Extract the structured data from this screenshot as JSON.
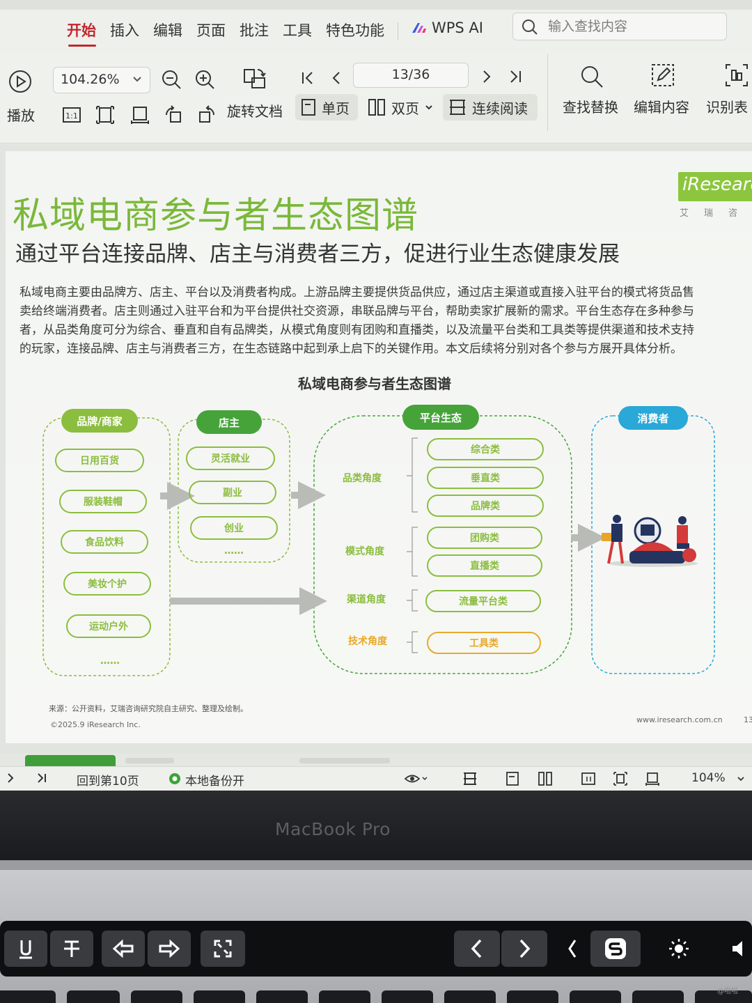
{
  "menu": {
    "items": [
      "开始",
      "插入",
      "编辑",
      "页面",
      "批注",
      "工具",
      "特色功能"
    ],
    "active": "开始",
    "wps_ai": "WPS AI",
    "search_placeholder": "输入查找内容"
  },
  "toolbar": {
    "play_label": "播放",
    "zoom_value": "104.26%",
    "page_indicator": "13/36",
    "rotate_label": "旋转文档",
    "single_page_label": "单页",
    "double_page_label": "双页",
    "continuous_label": "连续阅读",
    "find_replace_label": "查找替换",
    "edit_content_label": "编辑内容",
    "recognize_label": "识别表",
    "fit_label": "1:1"
  },
  "document": {
    "title": "私域电商参与者生态图谱",
    "subtitle": "通过平台连接品牌、店主与消费者三方，促进行业生态健康发展",
    "body_lines": [
      "私域电商主要由品牌方、店主、平台以及消费者构成。上游品牌主要提供货品供应，通过店主渠道或直接入驻平台的模式将货品售",
      "卖给终端消费者。店主则通过入驻平台和为平台提供社交资源，串联品牌与平台，帮助卖家扩展新的需求。平台生态存在多种参与",
      "者，从品类角度可分为综合、垂直和自有品牌类，从模式角度则有团购和直播类，以及流量平台类和工具类等提供渠道和技术支持",
      "的玩家，连接品牌、店主与消费者三方，在生态链路中起到承上启下的关键作用。本文后续将分别对各个参与方展开具体分析。"
    ],
    "logo_text": "iResearch",
    "logo_subtext": "艾瑞咨",
    "diagram_title": "私域电商参与者生态图谱",
    "source_note": "来源：公开资料，艾瑞咨询研究院自主研究、整理及绘制。",
    "copyright": "©2025.9 iResearch Inc.",
    "site": "www.iresearch.com.cn",
    "page_number": "13"
  },
  "diagram": {
    "brand": {
      "header": "品牌/商家",
      "items": [
        "日用百货",
        "服装鞋帽",
        "食品饮料",
        "美妆个护",
        "运动户外"
      ],
      "more": "……"
    },
    "shop": {
      "header": "店主",
      "items": [
        "灵活就业",
        "副业",
        "创业"
      ],
      "more": "……"
    },
    "platform": {
      "header": "平台生态",
      "groups": [
        {
          "angle": "品类角度",
          "items": [
            "综合类",
            "垂直类",
            "品牌类"
          ]
        },
        {
          "angle": "模式角度",
          "items": [
            "团购类",
            "直播类"
          ]
        },
        {
          "angle": "渠道角度",
          "items": [
            "流量平台类"
          ]
        },
        {
          "angle": "技术角度",
          "items": [
            "工具类"
          ]
        }
      ]
    },
    "consumer": {
      "header": "消费者"
    },
    "colors": {
      "green": "#8bbd3f",
      "head_green": "#46a33a",
      "orange": "#e8a92a",
      "blue": "#2aa8d8",
      "arrow": "#b9bbb6"
    }
  },
  "statusbar": {
    "back_to_page": "回到第10页",
    "local_backup": "本地备份开",
    "zoom": "104%"
  },
  "laptop": {
    "label": "MacBook Pro",
    "watermark": "@啦啦"
  }
}
